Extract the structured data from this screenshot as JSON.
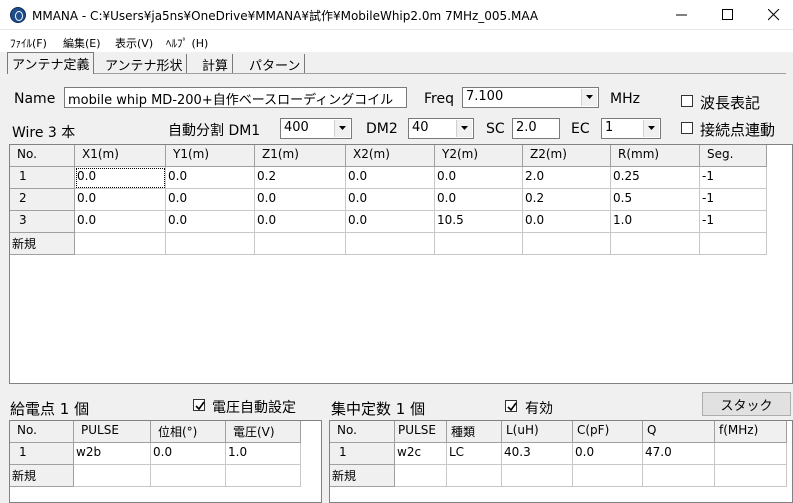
{
  "window": {
    "title": "MMANA - C:¥Users¥ja5ns¥OneDrive¥MMANA¥試作¥MobileWhip2.0m 7MHz_005.MAA"
  },
  "menu": [
    "ﾌｧｲﾙ(F)",
    "編集(E)",
    "表示(V)",
    "ﾍﾙﾌﾟ (H)"
  ],
  "tabs": [
    "アンテナ定義",
    "アンテナ形状",
    "計算",
    "パターン"
  ],
  "antenna": {
    "name_label": "Name",
    "name_value": "mobile whip  MD-200+自作ベースローディングコイル",
    "freq_label": "Freq",
    "freq_value": "7.100",
    "freq_unit": "MHz",
    "wavelength_label": "波長表記",
    "wavelength_checked": false,
    "wire_count": "Wire 3 本",
    "auto_split_label": "自動分割 DM1",
    "dm1_value": "400",
    "dm2_label": "DM2",
    "dm2_value": "40",
    "sc_label": "SC",
    "sc_value": "2.0",
    "ec_label": "EC",
    "ec_value": "1",
    "junction_label": "接続点連動",
    "junction_checked": false
  },
  "wire_table": {
    "columns": [
      "No.",
      "X1(m)",
      "Y1(m)",
      "Z1(m)",
      "X2(m)",
      "Y2(m)",
      "Z2(m)",
      "R(mm)",
      "Seg."
    ],
    "rows": [
      [
        "1",
        "0.0",
        "0.0",
        "0.2",
        "0.0",
        "0.0",
        "2.0",
        "0.25",
        "-1"
      ],
      [
        "2",
        "0.0",
        "0.0",
        "0.0",
        "0.0",
        "0.0",
        "0.2",
        "0.5",
        "-1"
      ],
      [
        "3",
        "0.0",
        "0.0",
        "0.0",
        "0.0",
        "10.5",
        "0.0",
        "1.0",
        "-1"
      ]
    ],
    "new_row_label": "新規"
  },
  "source": {
    "title": "給電点 1 個",
    "auto_voltage_label": "電圧自動設定",
    "auto_voltage_checked": true,
    "columns": [
      "No.",
      "PULSE",
      "位相(°)",
      "電圧(V)"
    ],
    "rows": [
      [
        "1",
        "w2b",
        "0.0",
        "1.0"
      ]
    ],
    "new_row_label": "新規"
  },
  "load": {
    "title": "集中定数 1 個",
    "enabled_label": "有効",
    "enabled_checked": true,
    "stack_button": "スタック",
    "columns": [
      "No.",
      "PULSE",
      "種類",
      "L(uH)",
      "C(pF)",
      "Q",
      "f(MHz)"
    ],
    "rows": [
      [
        "1",
        "w2c",
        "LC",
        "40.3",
        "0.0",
        "47.0",
        ""
      ]
    ],
    "new_row_label": "新規"
  }
}
